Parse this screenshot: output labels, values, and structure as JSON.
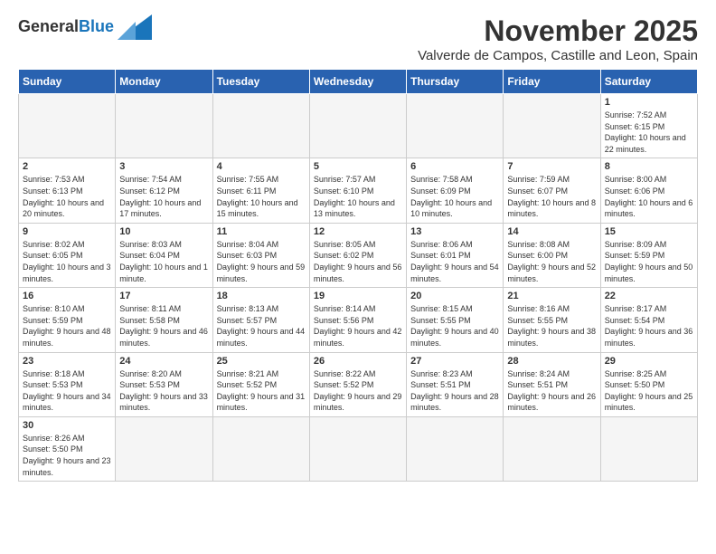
{
  "logo": {
    "line1": "General",
    "line2": "Blue"
  },
  "title": "November 2025",
  "subtitle": "Valverde de Campos, Castille and Leon, Spain",
  "days_of_week": [
    "Sunday",
    "Monday",
    "Tuesday",
    "Wednesday",
    "Thursday",
    "Friday",
    "Saturday"
  ],
  "weeks": [
    [
      {
        "day": "",
        "info": ""
      },
      {
        "day": "",
        "info": ""
      },
      {
        "day": "",
        "info": ""
      },
      {
        "day": "",
        "info": ""
      },
      {
        "day": "",
        "info": ""
      },
      {
        "day": "",
        "info": ""
      },
      {
        "day": "1",
        "info": "Sunrise: 7:52 AM\nSunset: 6:15 PM\nDaylight: 10 hours\nand 22 minutes."
      }
    ],
    [
      {
        "day": "2",
        "info": "Sunrise: 7:53 AM\nSunset: 6:13 PM\nDaylight: 10 hours\nand 20 minutes."
      },
      {
        "day": "3",
        "info": "Sunrise: 7:54 AM\nSunset: 6:12 PM\nDaylight: 10 hours\nand 17 minutes."
      },
      {
        "day": "4",
        "info": "Sunrise: 7:55 AM\nSunset: 6:11 PM\nDaylight: 10 hours\nand 15 minutes."
      },
      {
        "day": "5",
        "info": "Sunrise: 7:57 AM\nSunset: 6:10 PM\nDaylight: 10 hours\nand 13 minutes."
      },
      {
        "day": "6",
        "info": "Sunrise: 7:58 AM\nSunset: 6:09 PM\nDaylight: 10 hours\nand 10 minutes."
      },
      {
        "day": "7",
        "info": "Sunrise: 7:59 AM\nSunset: 6:07 PM\nDaylight: 10 hours\nand 8 minutes."
      },
      {
        "day": "8",
        "info": "Sunrise: 8:00 AM\nSunset: 6:06 PM\nDaylight: 10 hours\nand 6 minutes."
      }
    ],
    [
      {
        "day": "9",
        "info": "Sunrise: 8:02 AM\nSunset: 6:05 PM\nDaylight: 10 hours\nand 3 minutes."
      },
      {
        "day": "10",
        "info": "Sunrise: 8:03 AM\nSunset: 6:04 PM\nDaylight: 10 hours\nand 1 minute."
      },
      {
        "day": "11",
        "info": "Sunrise: 8:04 AM\nSunset: 6:03 PM\nDaylight: 9 hours\nand 59 minutes."
      },
      {
        "day": "12",
        "info": "Sunrise: 8:05 AM\nSunset: 6:02 PM\nDaylight: 9 hours\nand 56 minutes."
      },
      {
        "day": "13",
        "info": "Sunrise: 8:06 AM\nSunset: 6:01 PM\nDaylight: 9 hours\nand 54 minutes."
      },
      {
        "day": "14",
        "info": "Sunrise: 8:08 AM\nSunset: 6:00 PM\nDaylight: 9 hours\nand 52 minutes."
      },
      {
        "day": "15",
        "info": "Sunrise: 8:09 AM\nSunset: 5:59 PM\nDaylight: 9 hours\nand 50 minutes."
      }
    ],
    [
      {
        "day": "16",
        "info": "Sunrise: 8:10 AM\nSunset: 5:59 PM\nDaylight: 9 hours\nand 48 minutes."
      },
      {
        "day": "17",
        "info": "Sunrise: 8:11 AM\nSunset: 5:58 PM\nDaylight: 9 hours\nand 46 minutes."
      },
      {
        "day": "18",
        "info": "Sunrise: 8:13 AM\nSunset: 5:57 PM\nDaylight: 9 hours\nand 44 minutes."
      },
      {
        "day": "19",
        "info": "Sunrise: 8:14 AM\nSunset: 5:56 PM\nDaylight: 9 hours\nand 42 minutes."
      },
      {
        "day": "20",
        "info": "Sunrise: 8:15 AM\nSunset: 5:55 PM\nDaylight: 9 hours\nand 40 minutes."
      },
      {
        "day": "21",
        "info": "Sunrise: 8:16 AM\nSunset: 5:55 PM\nDaylight: 9 hours\nand 38 minutes."
      },
      {
        "day": "22",
        "info": "Sunrise: 8:17 AM\nSunset: 5:54 PM\nDaylight: 9 hours\nand 36 minutes."
      }
    ],
    [
      {
        "day": "23",
        "info": "Sunrise: 8:18 AM\nSunset: 5:53 PM\nDaylight: 9 hours\nand 34 minutes."
      },
      {
        "day": "24",
        "info": "Sunrise: 8:20 AM\nSunset: 5:53 PM\nDaylight: 9 hours\nand 33 minutes."
      },
      {
        "day": "25",
        "info": "Sunrise: 8:21 AM\nSunset: 5:52 PM\nDaylight: 9 hours\nand 31 minutes."
      },
      {
        "day": "26",
        "info": "Sunrise: 8:22 AM\nSunset: 5:52 PM\nDaylight: 9 hours\nand 29 minutes."
      },
      {
        "day": "27",
        "info": "Sunrise: 8:23 AM\nSunset: 5:51 PM\nDaylight: 9 hours\nand 28 minutes."
      },
      {
        "day": "28",
        "info": "Sunrise: 8:24 AM\nSunset: 5:51 PM\nDaylight: 9 hours\nand 26 minutes."
      },
      {
        "day": "29",
        "info": "Sunrise: 8:25 AM\nSunset: 5:50 PM\nDaylight: 9 hours\nand 25 minutes."
      }
    ],
    [
      {
        "day": "30",
        "info": "Sunrise: 8:26 AM\nSunset: 5:50 PM\nDaylight: 9 hours\nand 23 minutes."
      },
      {
        "day": "",
        "info": ""
      },
      {
        "day": "",
        "info": ""
      },
      {
        "day": "",
        "info": ""
      },
      {
        "day": "",
        "info": ""
      },
      {
        "day": "",
        "info": ""
      },
      {
        "day": "",
        "info": ""
      }
    ]
  ]
}
